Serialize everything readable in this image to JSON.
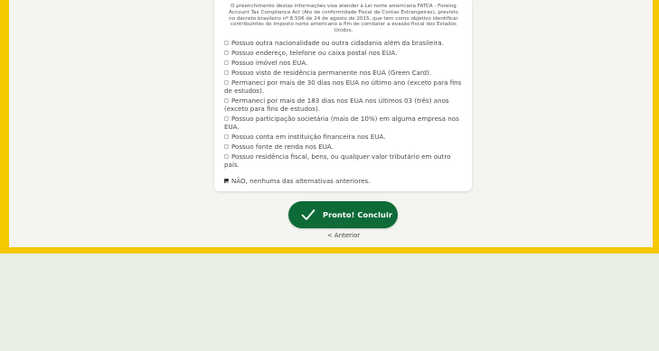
{
  "intro_text": "O preenchimento destas informações visa atender à Lei norte americana FATCA - Foreing Account Tax Compliance Act (Ato de conformidade Fiscal de Contas Estrangeiras), previsto no decreto brasileiro nº 8.506 de 24 de agosto de 2015, que tem como objetivo identificar contribuintes do imposto norte americano a fim de combater a evasão fiscal dos Estados Unidos.",
  "options": [
    {
      "label": "Possuo outra nacionalidade ou outra cidadania além da brasileira.",
      "checked": false
    },
    {
      "label": "Possuo endereço, telefone ou caixa postal nos EUA.",
      "checked": false
    },
    {
      "label": "Possuo imóvel nos EUA.",
      "checked": false
    },
    {
      "label": "Possuo visto de residência permanente nos EUA (Green Card).",
      "checked": false
    },
    {
      "label": "Permaneci por mais de 30 dias nos EUA no último ano (exceto para fins de estudos).",
      "checked": false
    },
    {
      "label": "Permaneci por mais de 183 dias nos EUA nos últimos 03 (três) anos (exceto para fins de estudos).",
      "checked": false
    },
    {
      "label": "Possuo participação societária (mais de 10%) em alguma empresa nos EUA.",
      "checked": false
    },
    {
      "label": "Possuo conta em instituição financeira nos EUA.",
      "checked": false
    },
    {
      "label": "Possuo fonte de renda nos EUA.",
      "checked": false
    },
    {
      "label": "Possuo residência fiscal, bens, ou qualquer valor tributário em outro país.",
      "checked": false
    }
  ],
  "none_option": {
    "label": "NÃO, nenhuma das alternativas anteriores.",
    "checked": true
  },
  "submit_label": "Pronto! Concluir",
  "previous_label": "< Anterior",
  "colors": {
    "accent": "#0e6b37",
    "frame": "#f5c800",
    "background": "#e9eee2"
  }
}
